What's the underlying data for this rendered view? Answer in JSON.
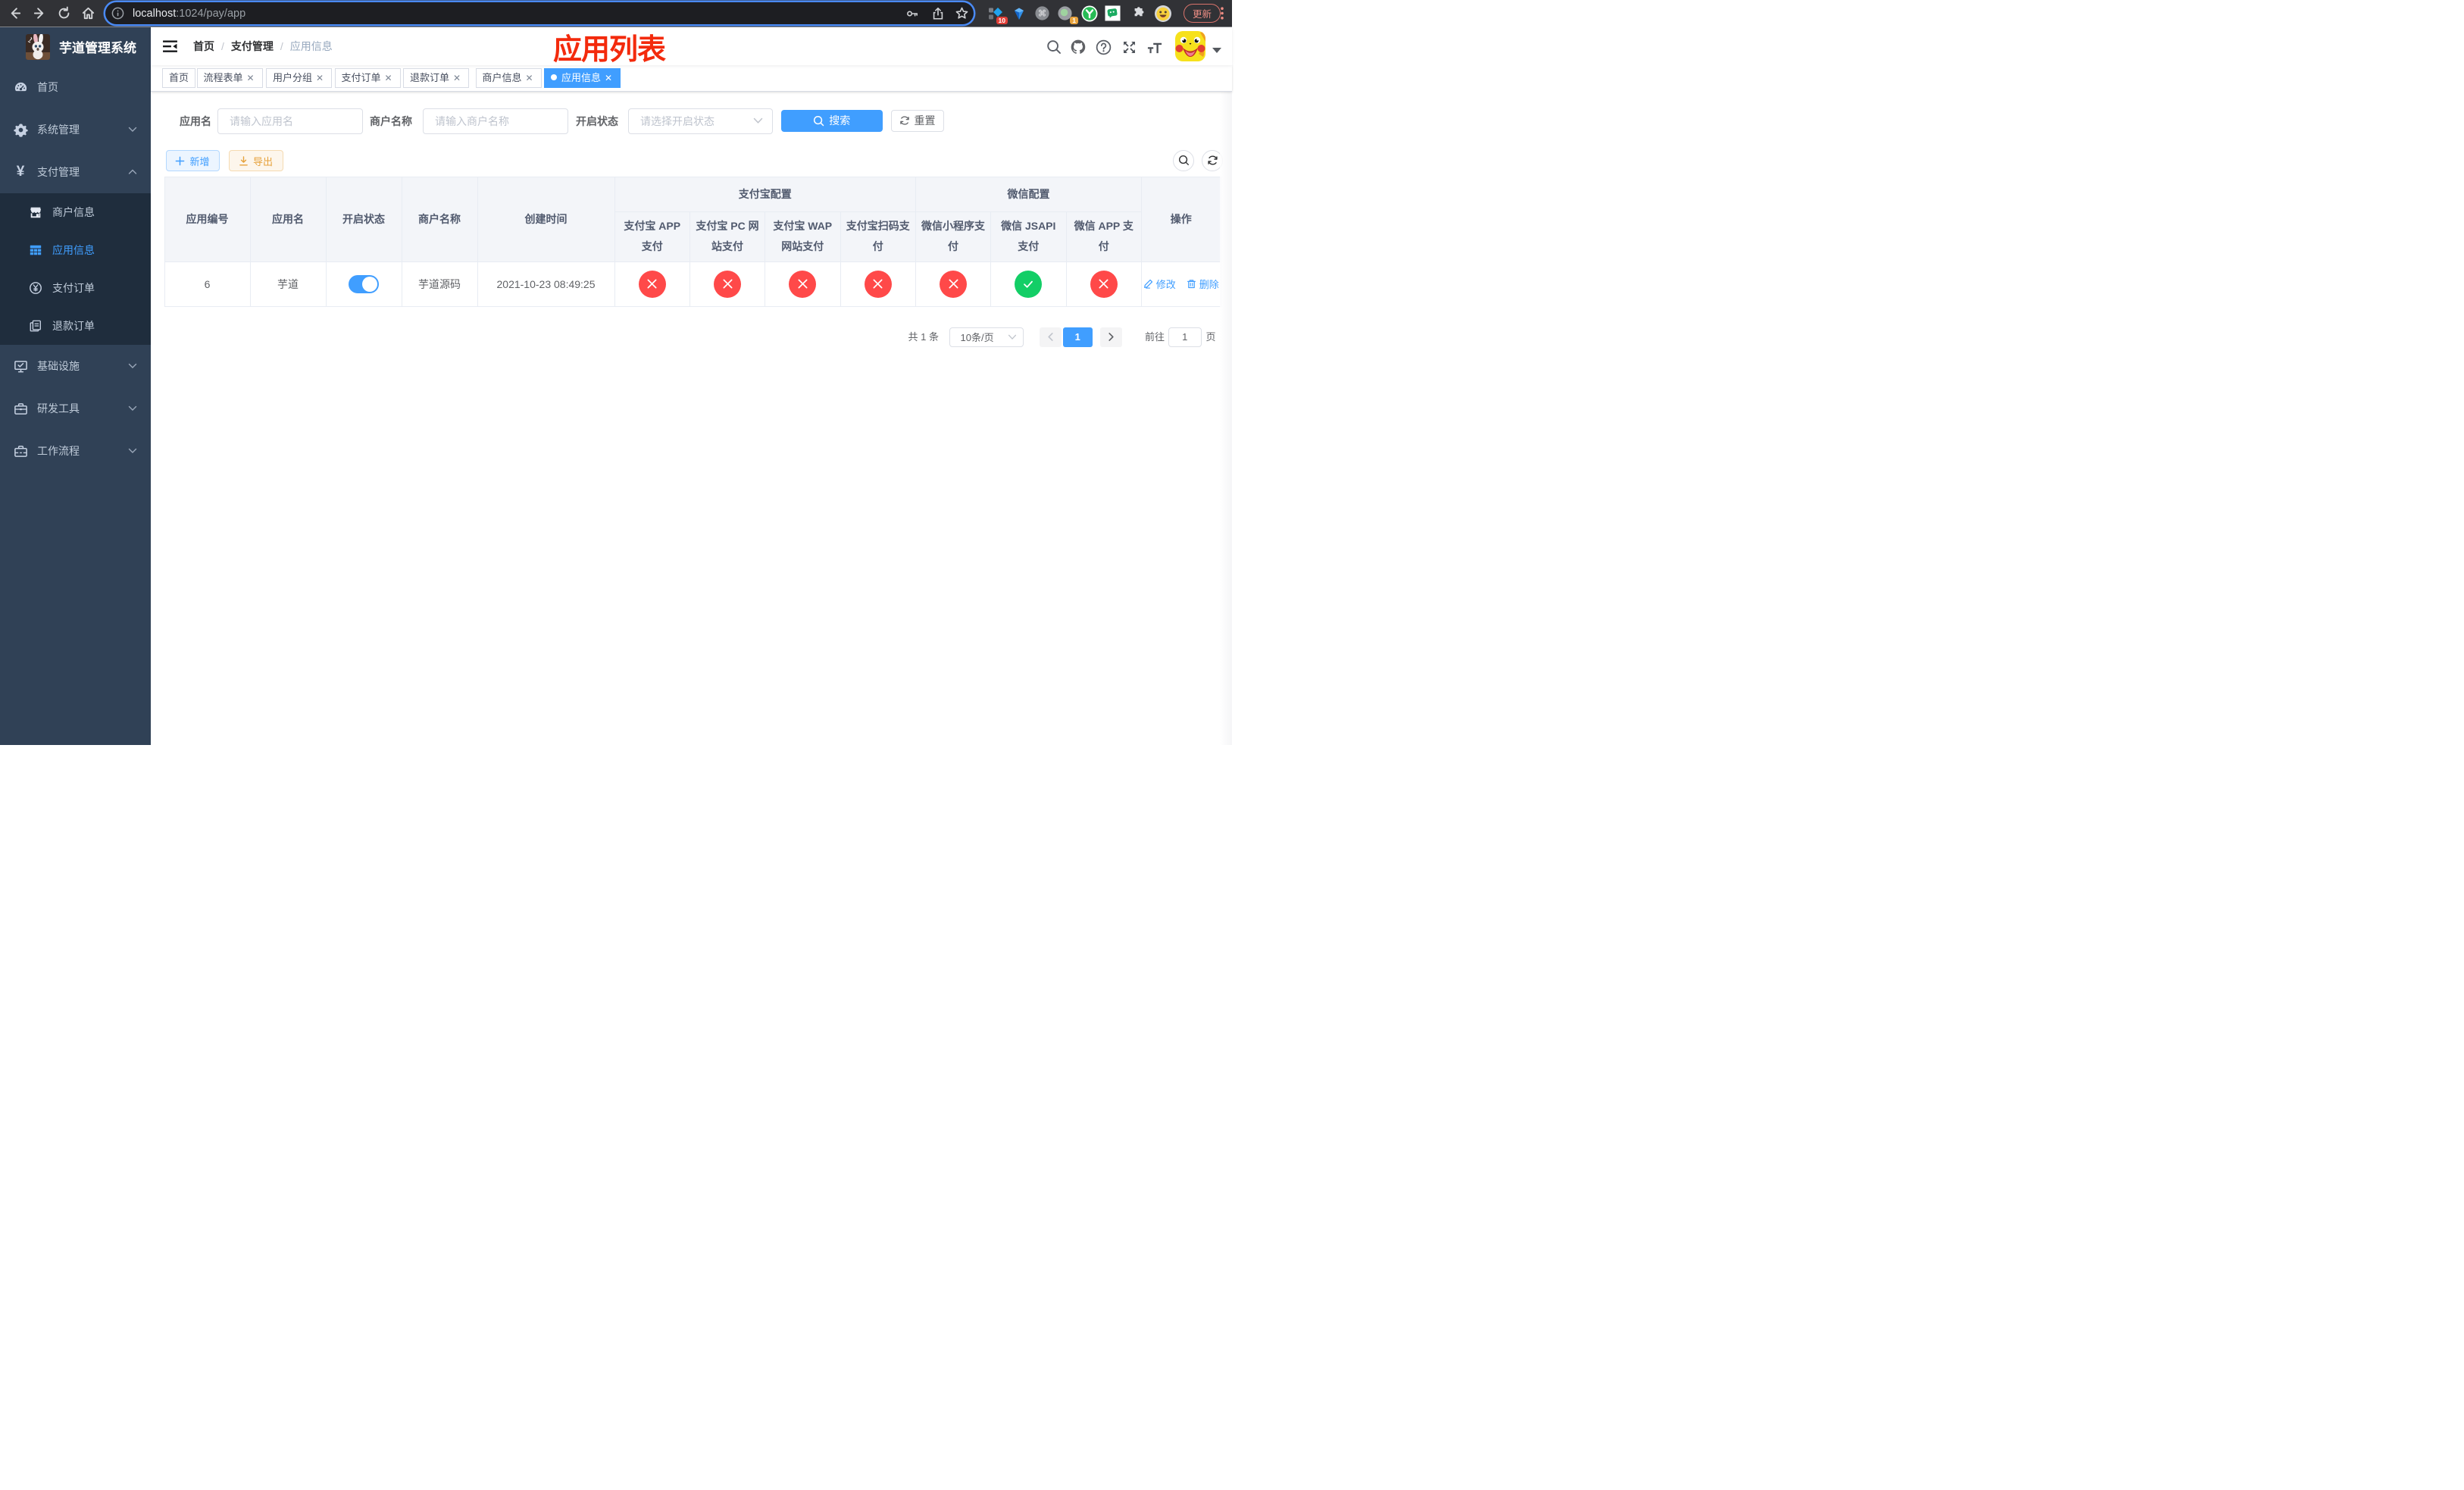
{
  "browser": {
    "url_host": "localhost",
    "url_rest": ":1024/pay/app",
    "ext_badge_count_10": "10",
    "ext_badge_count_1": "1",
    "update_button_label": "更新"
  },
  "sidebar": {
    "logo_title": "芋道管理系统",
    "items": [
      {
        "label": "首页",
        "icon": "dashboard-icon",
        "expandable": false
      },
      {
        "label": "系统管理",
        "icon": "gear-icon",
        "expandable": true,
        "expanded": false
      },
      {
        "label": "支付管理",
        "icon": "yuan-icon",
        "expandable": true,
        "expanded": true
      }
    ],
    "pay_submenu": [
      {
        "label": "商户信息",
        "icon": "shop-icon",
        "active": false
      },
      {
        "label": "应用信息",
        "icon": "grid-icon",
        "active": true
      },
      {
        "label": "支付订单",
        "icon": "yuan-circle-icon",
        "active": false
      },
      {
        "label": "退款订单",
        "icon": "documents-icon",
        "active": false
      }
    ],
    "items_after": [
      {
        "label": "基础设施",
        "icon": "monitor-icon",
        "expandable": true,
        "expanded": false
      },
      {
        "label": "研发工具",
        "icon": "briefcase-icon",
        "expandable": true,
        "expanded": false
      },
      {
        "label": "工作流程",
        "icon": "toolbox-icon",
        "expandable": true,
        "expanded": false
      }
    ]
  },
  "navbar": {
    "breadcrumb": [
      "首页",
      "支付管理",
      "应用信息"
    ],
    "separator": "/"
  },
  "annotation": {
    "text": "应用列表",
    "color": "#f32a0c"
  },
  "tags": [
    {
      "label": "首页",
      "closable": false,
      "active": false
    },
    {
      "label": "流程表单",
      "closable": true,
      "active": false
    },
    {
      "label": "用户分组",
      "closable": true,
      "active": false
    },
    {
      "label": "支付订单",
      "closable": true,
      "active": false
    },
    {
      "label": "退款订单",
      "closable": true,
      "active": false
    },
    {
      "label": "商户信息",
      "closable": true,
      "active": false
    },
    {
      "label": "应用信息",
      "closable": true,
      "active": true
    }
  ],
  "filters": {
    "app_name_label": "应用名",
    "app_name_placeholder": "请输入应用名",
    "merchant_label": "商户名称",
    "merchant_placeholder": "请输入商户名称",
    "status_label": "开启状态",
    "status_placeholder": "请选择开启状态",
    "search_label": "搜索",
    "reset_label": "重置"
  },
  "toolbar": {
    "add_label": "新增",
    "export_label": "导出"
  },
  "table": {
    "header": {
      "app_id": "应用编号",
      "app_name": "应用名",
      "status": "开启状态",
      "merchant_name": "商户名称",
      "create_time": "创建时间",
      "alipay_group": "支付宝配置",
      "wechat_group": "微信配置",
      "alipay_app": "支付宝 APP\n支付",
      "alipay_pc": "支付宝 PC 网\n站支付",
      "alipay_wap": "支付宝 WAP\n网站支付",
      "alipay_qr": "支付宝扫码支\n付",
      "wechat_lite": "微信小程序支\n付",
      "wechat_jsapi": "微信 JSAPI\n支付",
      "wechat_app": "微信 APP 支\n付",
      "actions": "操作"
    },
    "row": {
      "app_id": "6",
      "app_name": "芋道",
      "status_on": true,
      "merchant_name": "芋道源码",
      "create_time": "2021-10-23 08:49:25",
      "configs": [
        "cross",
        "cross",
        "cross",
        "cross",
        "cross",
        "check",
        "cross"
      ],
      "edit_label": "修改",
      "delete_label": "删除"
    }
  },
  "pagination": {
    "total_text": "共 1 条",
    "page_size_text": "10条/页",
    "current_page": "1",
    "goto_label": "前往",
    "goto_value": "1",
    "goto_suffix": "页"
  },
  "colors": {
    "accent": "#409eff",
    "danger": "#ff4949",
    "success": "#13ce66",
    "sidebar_bg": "#304156",
    "submenu_bg": "#1f2d3d",
    "annotation_red": "#f32a0c"
  }
}
